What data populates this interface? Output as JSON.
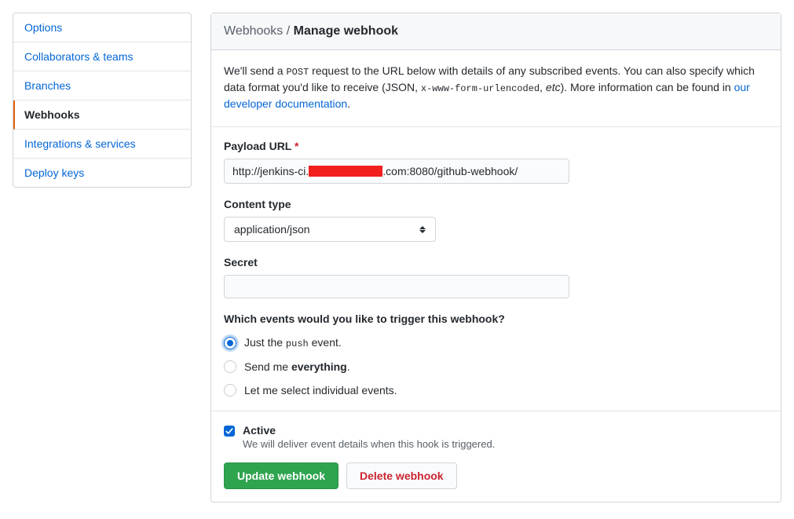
{
  "sidebar": {
    "items": [
      {
        "label": "Options"
      },
      {
        "label": "Collaborators & teams"
      },
      {
        "label": "Branches"
      },
      {
        "label": "Webhooks"
      },
      {
        "label": "Integrations & services"
      },
      {
        "label": "Deploy keys"
      }
    ]
  },
  "breadcrumb": {
    "parent": "Webhooks",
    "sep": "/",
    "current": "Manage webhook"
  },
  "description": {
    "pre": "We'll send a ",
    "code1": "POST",
    "mid1": " request to the URL below with details of any subscribed events. You can also specify which data format you'd like to receive (JSON, ",
    "code2": "x-www-form-urlencoded",
    "mid2": ", ",
    "em": "etc",
    "mid3": "). More information can be found in ",
    "link": "our developer documentation",
    "post": "."
  },
  "form": {
    "payload_url": {
      "label": "Payload URL",
      "required": "*",
      "value_prefix": "http://jenkins-ci.",
      "value_suffix": ".com:8080/github-webhook/"
    },
    "content_type": {
      "label": "Content type",
      "value": "application/json"
    },
    "secret": {
      "label": "Secret",
      "value": ""
    },
    "events": {
      "heading": "Which events would you like to trigger this webhook?",
      "opt1_pre": "Just the ",
      "opt1_code": "push",
      "opt1_post": " event.",
      "opt2_pre": "Send me ",
      "opt2_strong": "everything",
      "opt2_post": ".",
      "opt3": "Let me select individual events."
    },
    "active": {
      "label": "Active",
      "note": "We will deliver event details when this hook is triggered."
    },
    "actions": {
      "update": "Update webhook",
      "delete": "Delete webhook"
    }
  }
}
